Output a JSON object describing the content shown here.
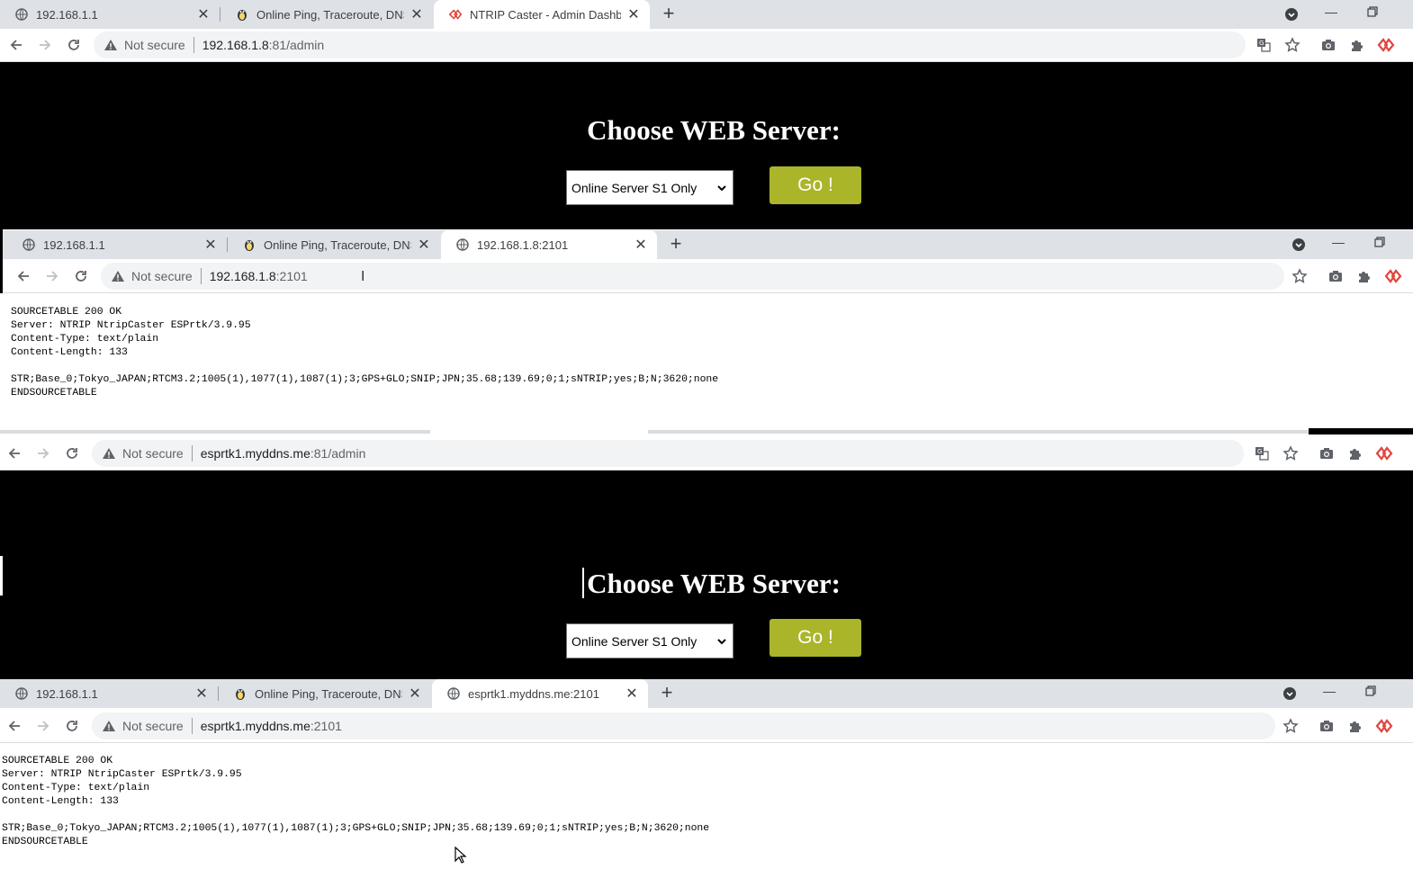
{
  "window1": {
    "tabs": [
      {
        "title": "192.168.1.1"
      },
      {
        "title": "Online Ping, Traceroute, DNS loo"
      },
      {
        "title": "NTRIP Caster - Admin Dashboarc"
      }
    ],
    "address": {
      "security": "Not secure",
      "host": "192.168.1.8",
      "path": ":81/admin"
    },
    "page": {
      "heading": "Choose WEB Server:",
      "select_value": "Online Server S1 Only",
      "go_label": "Go !"
    }
  },
  "window2": {
    "tabs": [
      {
        "title": "192.168.1.1"
      },
      {
        "title": "Online Ping, Traceroute, DNS loo"
      },
      {
        "title": "192.168.1.8:2101"
      }
    ],
    "address": {
      "security": "Not secure",
      "host": "192.168.1.8",
      "path": ":2101"
    },
    "page": {
      "lines": [
        "SOURCETABLE 200 OK",
        "Server: NTRIP NtripCaster ESPrtk/3.9.95",
        "Content-Type: text/plain",
        "Content-Length: 133",
        "",
        "STR;Base_0;Tokyo_JAPAN;RTCM3.2;1005(1),1077(1),1087(1);3;GPS+GLO;SNIP;JPN;35.68;139.69;0;1;sNTRIP;yes;B;N;3620;none",
        "ENDSOURCETABLE"
      ]
    }
  },
  "window3": {
    "address": {
      "security": "Not secure",
      "host": "esprtk1.myddns.me",
      "path": ":81/admin"
    },
    "page": {
      "heading": "Choose WEB Server:",
      "select_value": "Online Server S1 Only",
      "go_label": "Go !"
    }
  },
  "window4": {
    "tabs": [
      {
        "title": "192.168.1.1"
      },
      {
        "title": "Online Ping, Traceroute, DNS loo"
      },
      {
        "title": "esprtk1.myddns.me:2101"
      }
    ],
    "address": {
      "security": "Not secure",
      "host": "esprtk1.myddns.me",
      "path": ":2101"
    },
    "page": {
      "lines": [
        "SOURCETABLE 200 OK",
        "Server: NTRIP NtripCaster ESPrtk/3.9.95",
        "Content-Type: text/plain",
        "Content-Length: 133",
        "",
        "STR;Base_0;Tokyo_JAPAN;RTCM3.2;1005(1),1077(1),1087(1);3;GPS+GLO;SNIP;JPN;35.68;139.69;0;1;sNTRIP;yes;B;N;3620;none",
        "ENDSOURCETABLE"
      ]
    }
  },
  "colors": {
    "go_button": "#aab52a",
    "dashboard_bg": "#000000",
    "tabstrip": "#dee1e6"
  }
}
